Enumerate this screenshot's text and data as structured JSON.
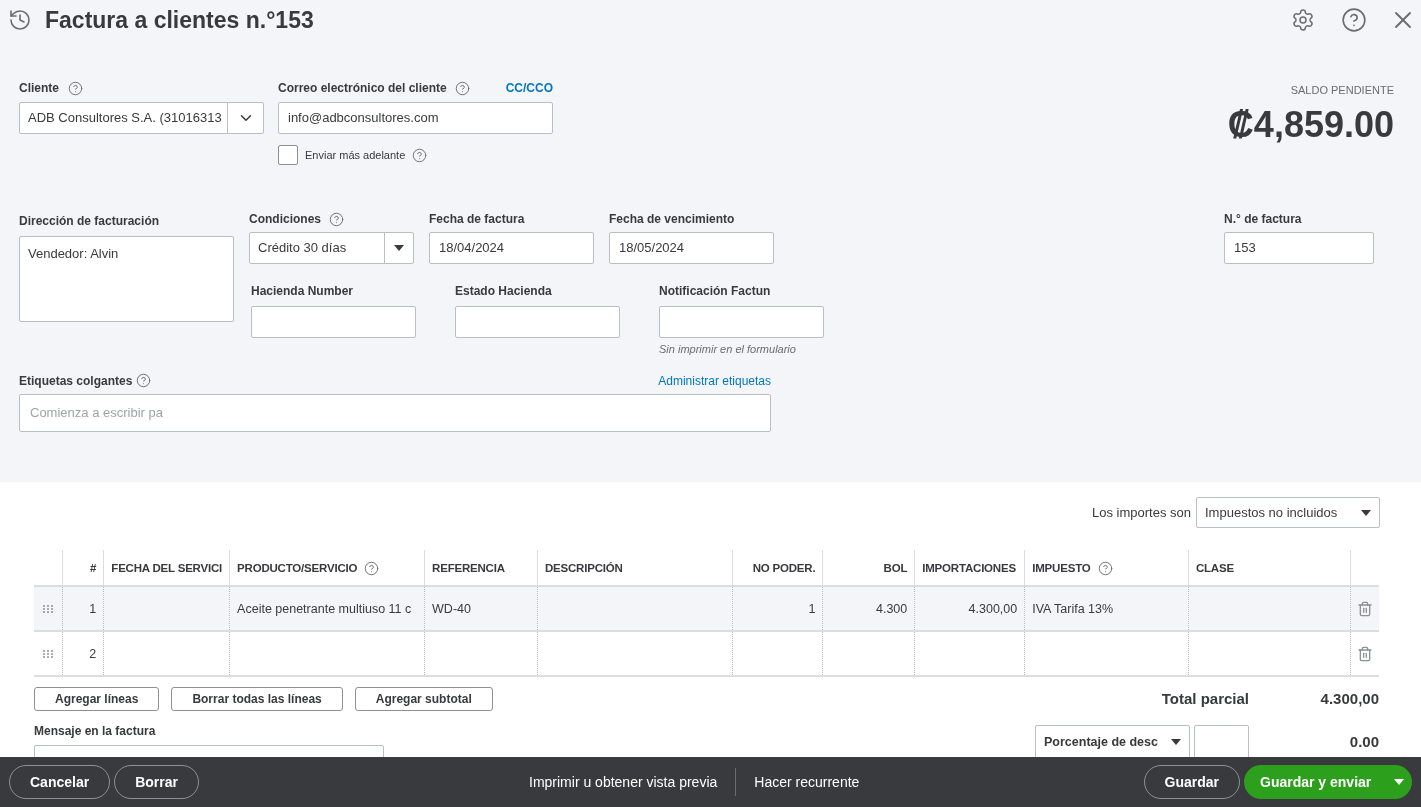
{
  "header": {
    "title": "Factura a clientes n.°153"
  },
  "customer": {
    "label": "Cliente",
    "value": "ADB Consultores S.A. (31016313"
  },
  "email": {
    "label": "Correo electrónico del cliente",
    "cc_link": "CC/CCO",
    "value": "info@adbconsultores.com",
    "send_later": {
      "label": "Enviar más adelante",
      "checked": false
    }
  },
  "balance": {
    "label": "SALDO PENDIENTE",
    "amount": "₡4,859.00"
  },
  "billing_address": {
    "label": "Dirección de facturación",
    "value": "Vendedor: Alvin"
  },
  "terms": {
    "label": "Condiciones",
    "value": "Crédito 30 días"
  },
  "invoice_date": {
    "label": "Fecha de factura",
    "value": "18/04/2024"
  },
  "due_date": {
    "label": "Fecha de vencimiento",
    "value": "18/05/2024"
  },
  "invoice_number": {
    "label": "N.° de factura",
    "value": "153"
  },
  "custom_fields": [
    {
      "label": "Hacienda Number"
    },
    {
      "label": "Estado Hacienda"
    },
    {
      "label": "Notificación Factun",
      "note": "Sin imprimir en el formulario"
    }
  ],
  "tags": {
    "label": "Etiquetas colgantes",
    "manage_link": "Administrar etiquetas",
    "placeholder": "Comienza a escribir pa"
  },
  "amounts_are": {
    "label": "Los importes son",
    "value": "Impuestos no incluidos"
  },
  "table": {
    "columns": [
      {
        "label": "#",
        "help": false
      },
      {
        "label": "FECHA DEL SERVICI",
        "help": false
      },
      {
        "label": "PRODUCTO/SERVICIO",
        "help": true
      },
      {
        "label": "REFERENCIA",
        "help": false
      },
      {
        "label": "DESCRIPCIÓN",
        "help": false
      },
      {
        "label": "NO PODER.",
        "help": false
      },
      {
        "label": "BOL",
        "help": false
      },
      {
        "label": "IMPORTACIONES",
        "help": false
      },
      {
        "label": "IMPUESTO",
        "help": true
      },
      {
        "label": "CLASE",
        "help": false
      }
    ],
    "rows": [
      {
        "selected": true,
        "cells": [
          "1",
          "",
          "Aceite penetrante multiuso 11 c",
          "WD-40",
          "",
          "1",
          "4.300",
          "4.300,00",
          "IVA Tarifa 13%",
          ""
        ]
      },
      {
        "selected": false,
        "cells": [
          "2",
          "",
          "",
          "",
          "",
          "",
          "",
          "",
          "",
          ""
        ]
      }
    ]
  },
  "table_buttons": [
    "Agregar líneas",
    "Borrar todas las líneas",
    "Agregar subtotal"
  ],
  "message": {
    "label": "Mensaje en la factura"
  },
  "subtotal": {
    "label": "Total parcial",
    "value": "4.300,00"
  },
  "discount": {
    "type": "Porcentaje de desc",
    "value": "0.00"
  },
  "footer": {
    "left": [
      "Cancelar",
      "Borrar"
    ],
    "center": [
      "Imprimir u obtener vista previa",
      "Hacer recurrente"
    ],
    "save": "Guardar",
    "save_send": "Guardar y enviar"
  }
}
